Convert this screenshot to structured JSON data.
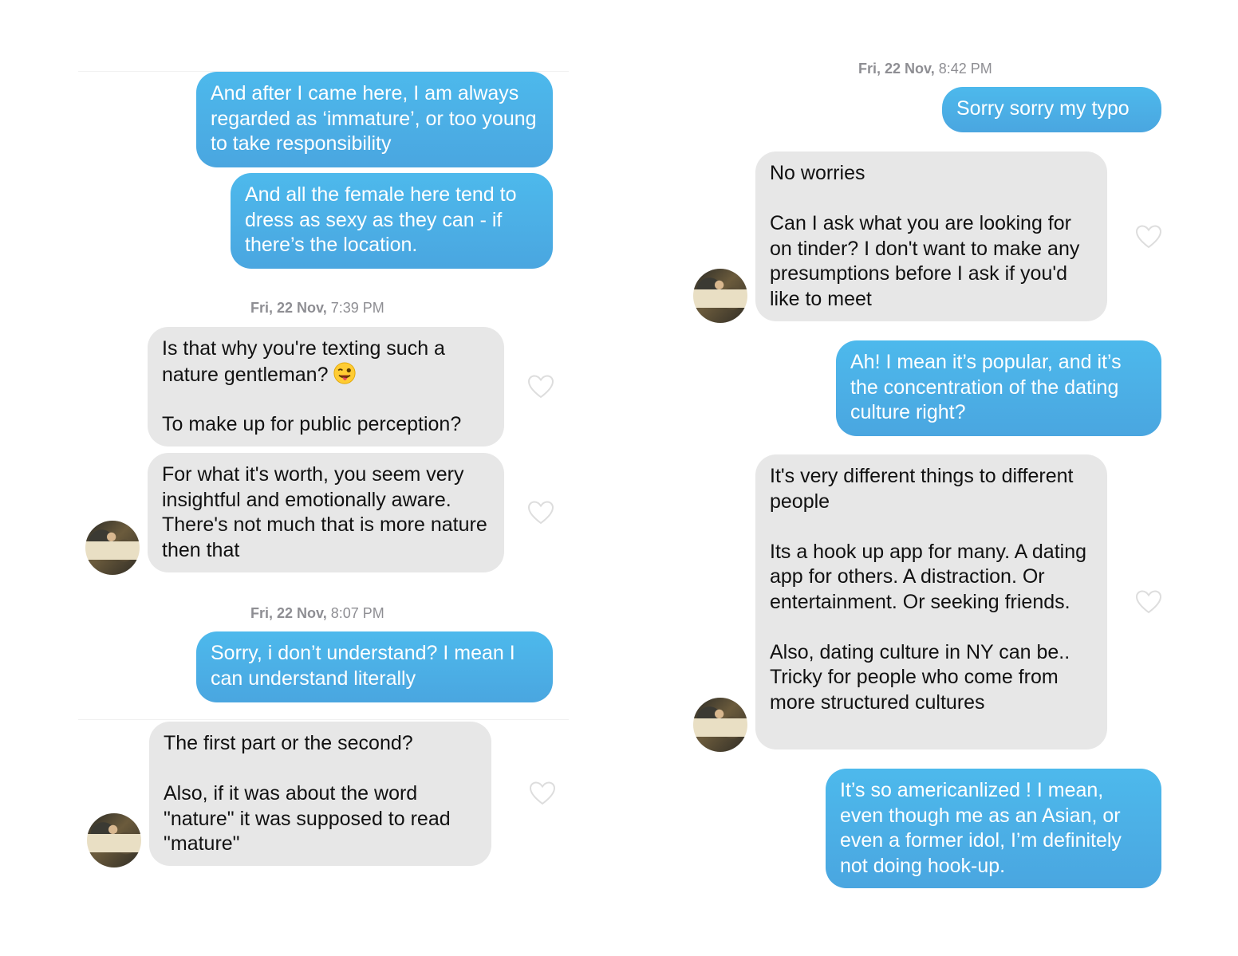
{
  "left_panel": {
    "messages": [
      {
        "from": "me",
        "text": "And after I came here, I am always regarded as ‘immature’, or too young to take responsibility"
      },
      {
        "from": "me",
        "text": "And all the female here tend to dress as sexy as they can - if there’s the location."
      },
      {
        "type": "timestamp",
        "day": "Fri, 22 Nov,",
        "time": "7:39 PM"
      },
      {
        "from": "them",
        "text_a": "Is that why you're texting such a nature gentleman?",
        "emoji": "winking-face-with-tongue",
        "text_b": "To make up for public perception?"
      },
      {
        "from": "them",
        "text": "For what it's worth, you seem very insightful and emotionally aware. There's not much that is more nature then that"
      },
      {
        "type": "timestamp",
        "day": "Fri, 22 Nov,",
        "time": "8:07 PM"
      },
      {
        "from": "me",
        "text": "Sorry, i don’t understand? I mean I can understand literally"
      },
      {
        "from": "them",
        "text": "The first part or the second?\n\nAlso, if it was about the word \"nature\" it was supposed to read \"mature\""
      }
    ]
  },
  "right_panel": {
    "messages": [
      {
        "type": "timestamp",
        "day": "Fri, 22 Nov,",
        "time": "8:42 PM"
      },
      {
        "from": "me",
        "text": "Sorry sorry my typo"
      },
      {
        "from": "them",
        "text": "No worries\n\nCan I ask what you are looking for on tinder? I don't want to make any presumptions before I ask if you'd like to meet"
      },
      {
        "from": "me",
        "text": "Ah! I mean it’s popular, and it’s the concentration of the dating culture right?"
      },
      {
        "from": "them",
        "text": "It's very different things to different people\n\nIts a hook up app for many. A dating app for others. A distraction. Or entertainment. Or seeking friends.\n\nAlso, dating culture in NY can be.. Tricky for people who come from more structured cultures"
      },
      {
        "from": "me",
        "text": "It’s so americanlized ! I mean, even though me as an Asian, or even a former idol, I’m definitely not doing hook-up."
      }
    ]
  },
  "colors": {
    "outgoing_bubble": "#4ab3e8",
    "incoming_bubble": "#e7e7e7",
    "timestamp": "#8e8e93",
    "heart_outline": "#dddddd"
  },
  "icons": {
    "like": "heart-outline-icon",
    "avatar": "match-avatar"
  }
}
